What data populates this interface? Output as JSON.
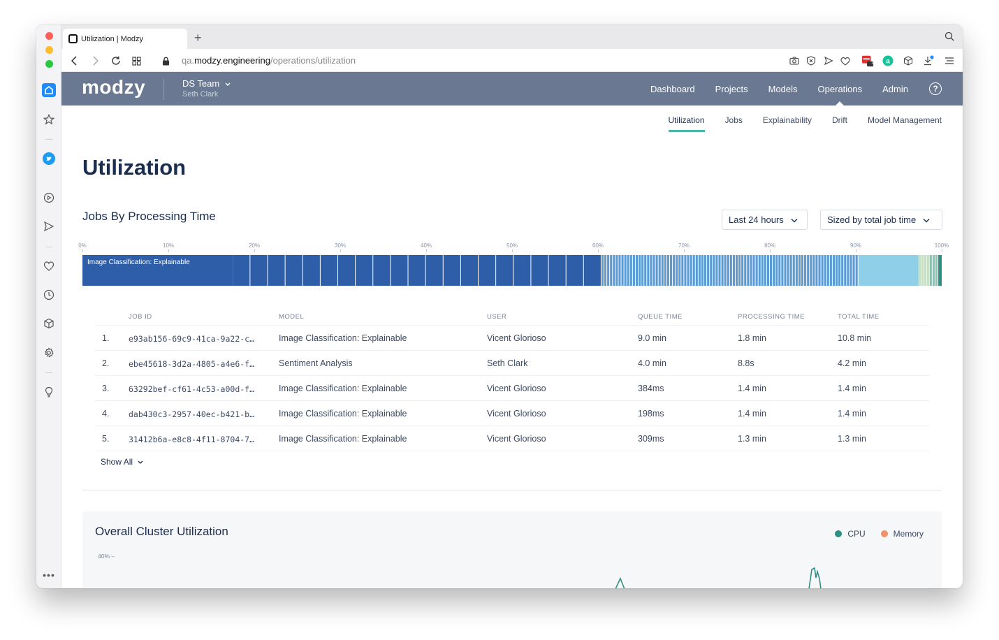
{
  "browser": {
    "tab_title": "Utilization | Modzy",
    "url_sub": "qa.",
    "url_host": "modzy.engineering",
    "url_path": "/operations/utilization",
    "new_tab_label": "+",
    "ext_badge": "1"
  },
  "header": {
    "logo": "modzy",
    "team_name": "DS Team",
    "team_user": "Seth Clark",
    "nav": [
      {
        "label": "Dashboard"
      },
      {
        "label": "Projects"
      },
      {
        "label": "Models"
      },
      {
        "label": "Operations",
        "active": true
      },
      {
        "label": "Admin"
      }
    ],
    "help_label": "?"
  },
  "subnav": [
    {
      "label": "Utilization",
      "active": true
    },
    {
      "label": "Jobs"
    },
    {
      "label": "Explainability"
    },
    {
      "label": "Drift"
    },
    {
      "label": "Model Management"
    }
  ],
  "page_title": "Utilization",
  "jobs_section": {
    "title": "Jobs By Processing Time",
    "time_range": "Last 24 hours",
    "sizing": "Sized by total job time",
    "bar_label": "Image Classification: Explainable",
    "axis_ticks": [
      "0%",
      "10%",
      "20%",
      "30%",
      "40%",
      "50%",
      "60%",
      "70%",
      "80%",
      "90%",
      "100%"
    ],
    "segments_pct": [
      {
        "start": 0,
        "end": 17.5,
        "color": "#2f5ea8"
      },
      {
        "start": 17.5,
        "end": 60.4,
        "color": "#2f5ea8",
        "divisions": 21
      },
      {
        "start": 60.4,
        "end": 90.3,
        "color": "#5b9bd5",
        "divisions": 90
      },
      {
        "start": 90.3,
        "end": 97.3,
        "color": "#8fcfe8"
      },
      {
        "start": 97.3,
        "end": 98.6,
        "color": "#c5e3c0",
        "divisions": 4
      },
      {
        "start": 98.6,
        "end": 99.6,
        "color": "#7fc7b5",
        "divisions": 3
      },
      {
        "start": 99.6,
        "end": 100,
        "color": "#2e8f83"
      }
    ]
  },
  "table": {
    "headers": {
      "job_id": "JOB ID",
      "model": "MODEL",
      "user": "USER",
      "queue": "QUEUE TIME",
      "processing": "PROCESSING TIME",
      "total": "TOTAL TIME"
    },
    "rows": [
      {
        "num": "1.",
        "job_id": "e93ab156-69c9-41ca-9a22-c…",
        "model": "Image Classification: Explainable",
        "user": "Vicent Glorioso",
        "queue": "9.0 min",
        "processing": "1.8 min",
        "total": "10.8 min"
      },
      {
        "num": "2.",
        "job_id": "ebe45618-3d2a-4805-a4e6-f…",
        "model": "Sentiment Analysis",
        "user": "Seth Clark",
        "queue": "4.0 min",
        "processing": "8.8s",
        "total": "4.2 min"
      },
      {
        "num": "3.",
        "job_id": "63292bef-cf61-4c53-a00d-f…",
        "model": "Image Classification: Explainable",
        "user": "Vicent Glorioso",
        "queue": "384ms",
        "processing": "1.4 min",
        "total": "1.4 min"
      },
      {
        "num": "4.",
        "job_id": "dab430c3-2957-40ec-b421-b…",
        "model": "Image Classification: Explainable",
        "user": "Vicent Glorioso",
        "queue": "198ms",
        "processing": "1.4 min",
        "total": "1.4 min"
      },
      {
        "num": "5.",
        "job_id": "31412b6a-e8c8-4f11-8704-7…",
        "model": "Image Classification: Explainable",
        "user": "Vicent Glorioso",
        "queue": "309ms",
        "processing": "1.3 min",
        "total": "1.3 min"
      }
    ],
    "show_all": "Show All"
  },
  "cluster": {
    "title": "Overall Cluster Utilization",
    "legend": [
      {
        "name": "CPU",
        "color": "#2e8f83"
      },
      {
        "name": "Memory",
        "color": "#f4906a"
      }
    ],
    "y_top_label": "40% –"
  },
  "colors": {
    "header_bg": "#6b7891",
    "accent": "#48b7a8",
    "title": "#1b2d4f"
  }
}
